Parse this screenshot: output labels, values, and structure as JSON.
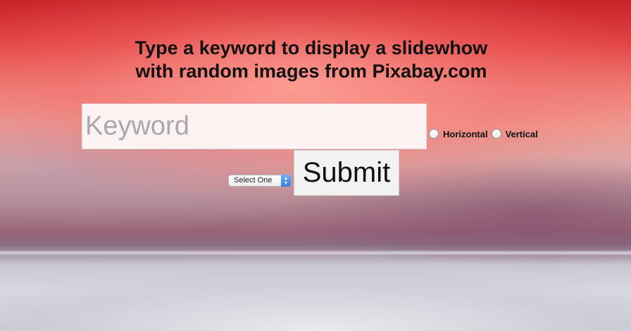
{
  "heading": {
    "line1": "Type a keyword to display a slidewhow",
    "line2": "with random images from Pixabay.com"
  },
  "form": {
    "keyword_placeholder": "Keyword",
    "keyword_value": "",
    "orientation_options": [
      {
        "label": "Horizontal",
        "checked": false
      },
      {
        "label": "Vertical",
        "checked": false
      }
    ],
    "select_value": "Select One",
    "submit_label": "Submit"
  },
  "icons": {
    "select_arrows": "chevron-up-down-icon",
    "radio": "radio-button-icon"
  }
}
